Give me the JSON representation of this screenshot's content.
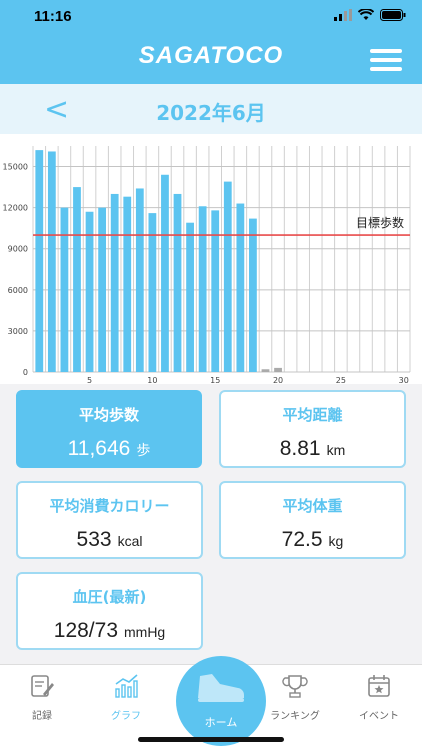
{
  "status": {
    "time": "11:16"
  },
  "header": {
    "logo": "SAGATOCO"
  },
  "month_nav": {
    "prev": "<",
    "title": "2022年6月"
  },
  "chart_data": {
    "type": "bar",
    "x": [
      1,
      2,
      3,
      4,
      5,
      6,
      7,
      8,
      9,
      10,
      11,
      12,
      13,
      14,
      15,
      16,
      17,
      18,
      19,
      20,
      21,
      22,
      23,
      24,
      25,
      26,
      27,
      28,
      29,
      30
    ],
    "values": [
      16200,
      16100,
      12000,
      13500,
      11700,
      12000,
      13000,
      12800,
      13400,
      11600,
      14400,
      13000,
      10900,
      12100,
      11800,
      13900,
      12300,
      11200,
      200,
      300,
      0,
      0,
      0,
      0,
      0,
      0,
      0,
      0,
      0,
      0
    ],
    "yticks": [
      "0",
      "3000",
      "6000",
      "9000",
      "12000",
      "15000"
    ],
    "xticks": [
      "5",
      "10",
      "15",
      "20",
      "25",
      "30"
    ],
    "ylim": [
      0,
      16500
    ],
    "target": {
      "value": 10000,
      "label": "目標歩数",
      "color": "#e84b4b"
    },
    "bar_color": "#5cc4f0",
    "inactive_color": "#aaaaaa",
    "grid": true
  },
  "stats": {
    "avg_steps": {
      "label": "平均歩数",
      "value": "11,646",
      "unit": "歩"
    },
    "avg_distance": {
      "label": "平均距離",
      "value": "8.81",
      "unit": "km"
    },
    "avg_calories": {
      "label": "平均消費カロリー",
      "value": "533",
      "unit": "kcal"
    },
    "avg_weight": {
      "label": "平均体重",
      "value": "72.5",
      "unit": "kg"
    },
    "blood_pressure": {
      "label": "血圧(最新)",
      "value": "128/73",
      "unit": "mmHg"
    }
  },
  "tabs": [
    {
      "label": "記録",
      "icon": "record-icon"
    },
    {
      "label": "グラフ",
      "icon": "graph-icon"
    },
    {
      "label": "ホーム",
      "icon": "shoe-icon"
    },
    {
      "label": "ランキング",
      "icon": "trophy-icon"
    },
    {
      "label": "イベント",
      "icon": "calendar-icon"
    }
  ],
  "colors": {
    "accent": "#5cc4f0",
    "target_line": "#e84b4b"
  }
}
